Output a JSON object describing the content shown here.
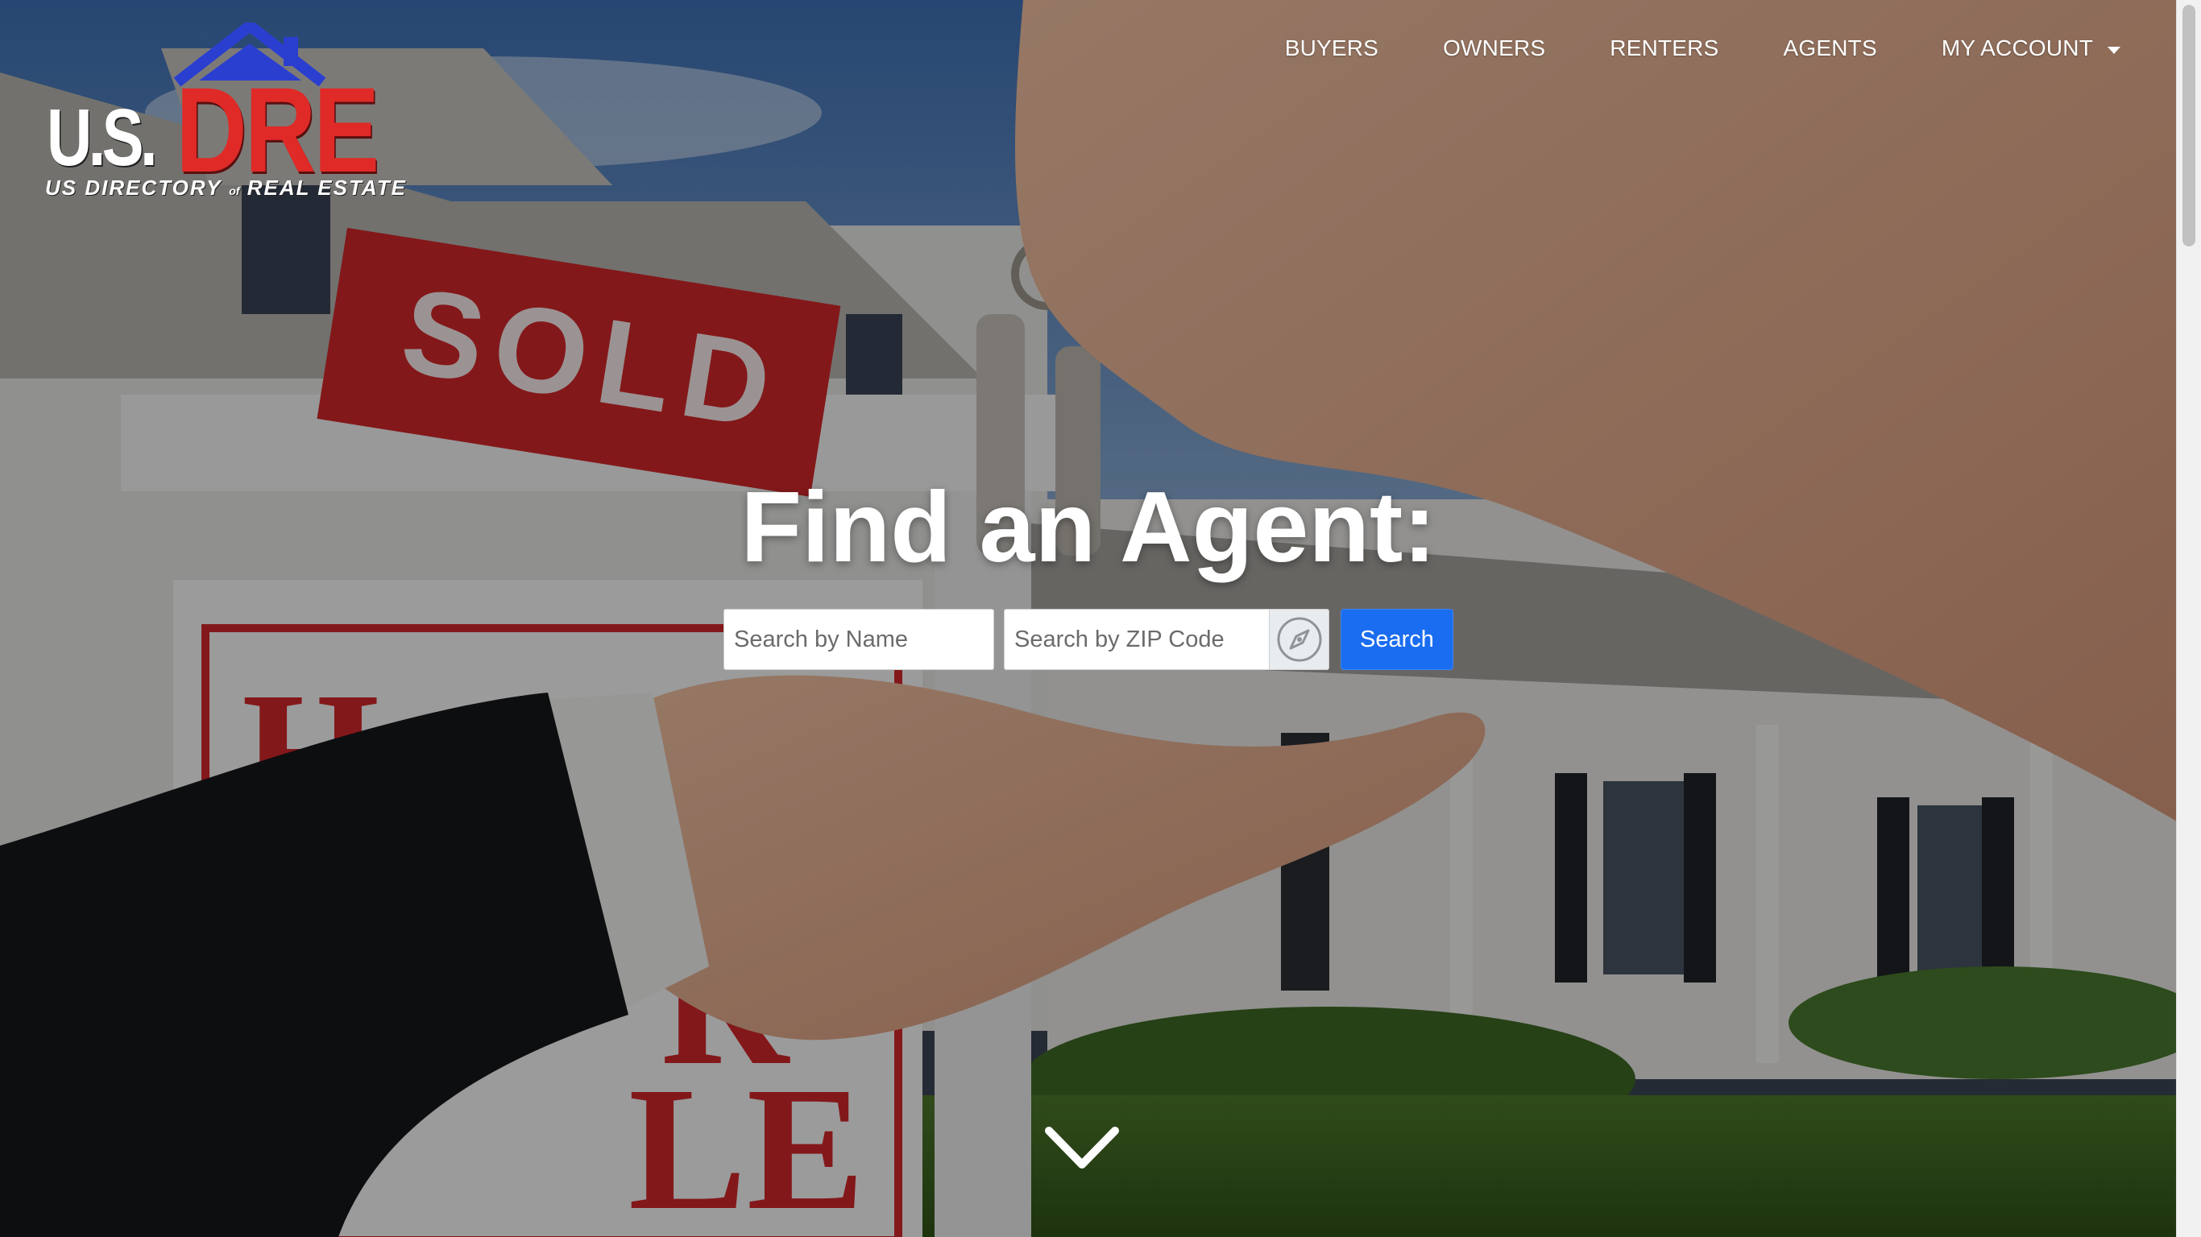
{
  "brand": {
    "logo_mark_left": "U.S.",
    "logo_mark_right": "DRE",
    "logo_tagline_1": "US DIRECTORY",
    "logo_tagline_of": "of",
    "logo_tagline_2": "REAL ESTATE"
  },
  "nav": {
    "items": [
      {
        "label": "BUYERS"
      },
      {
        "label": "OWNERS"
      },
      {
        "label": "RENTERS"
      },
      {
        "label": "AGENTS"
      }
    ],
    "account_label": "MY ACCOUNT"
  },
  "hero": {
    "headline": "Find an Agent:",
    "sign_text": "SOLD"
  },
  "search": {
    "name_placeholder": "Search by Name",
    "zip_placeholder": "Search by ZIP Code",
    "button_label": "Search"
  },
  "icons": {
    "locate": "compass-icon",
    "scroll": "chevron-down-icon",
    "account_menu": "caret-down-icon"
  },
  "colors": {
    "accent": "#1a6df0",
    "logo_red": "#e02a27",
    "logo_blue": "#2a3fd0",
    "sign_red": "#d4282a"
  }
}
